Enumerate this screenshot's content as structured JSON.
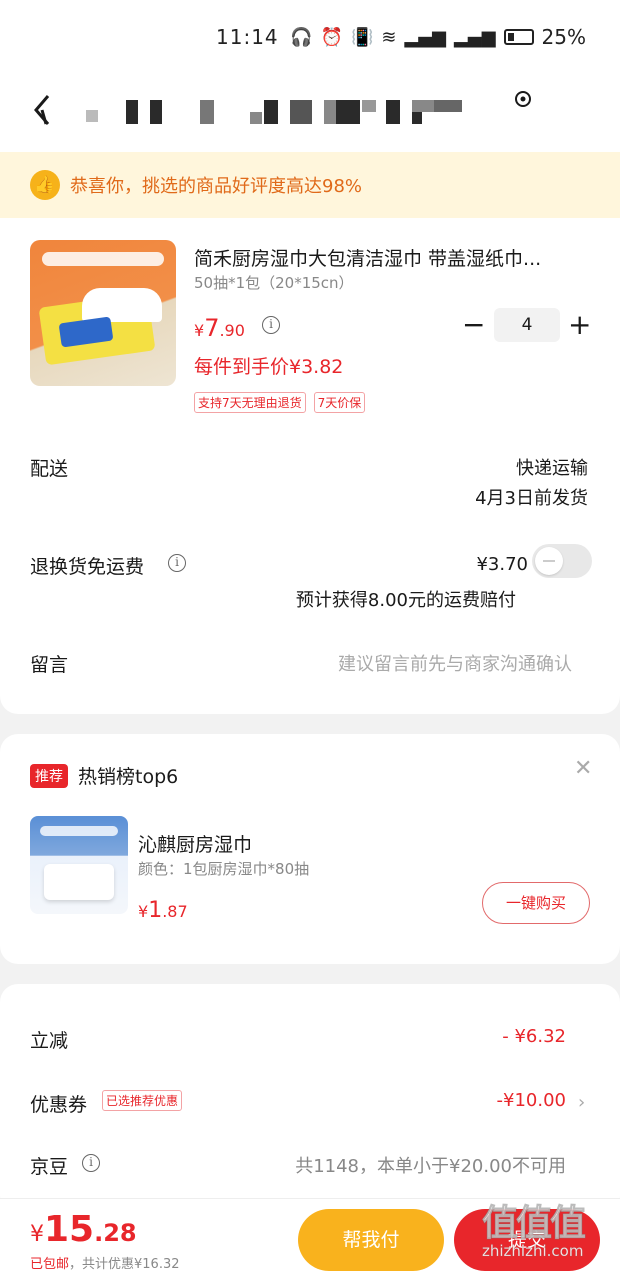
{
  "status_bar": {
    "time": "11:14",
    "battery": "25%"
  },
  "nav": {
    "back_icon": "back-chevron-icon",
    "location_icon": "location-pin-icon"
  },
  "banner": {
    "text": "恭喜你，挑选的商品好评度高达98%",
    "icon": "thumbs-up-icon"
  },
  "product": {
    "title": "简禾厨房湿巾大包清洁湿巾 带盖湿纸巾...",
    "spec": "50抽*1包（20*15cn）",
    "price_symbol": "¥",
    "price_int": "7",
    "price_dec": ".90",
    "net_price": "每件到手价¥3.82",
    "tags": [
      "支持7天无理由退货",
      "7天价保"
    ],
    "quantity": "4"
  },
  "delivery": {
    "label": "配送",
    "method": "快递运输",
    "ship_date": "4月3日前发货"
  },
  "return_shipping": {
    "label": "退换货免运费",
    "price": "¥3.70",
    "note": "预计获得8.00元的运费赔付",
    "enabled": false
  },
  "message": {
    "label": "留言",
    "placeholder": "建议留言前先与商家沟通确认"
  },
  "hot_list": {
    "badge": "推荐",
    "title": "热销榜top6",
    "item": {
      "name": "沁麒厨房湿巾",
      "spec": "颜色：1包厨房湿巾*80抽",
      "price_symbol": "¥",
      "price_int": "1",
      "price_dec": ".87",
      "buy_label": "一键购买"
    }
  },
  "summary": {
    "discount_label": "立减",
    "discount_value": "- ¥6.32",
    "coupon_label": "优惠券",
    "coupon_badge": "已选推荐优惠",
    "coupon_value": "-¥10.00",
    "beans_label": "京豆",
    "beans_note": "共1148，本单小于¥20.00不可用"
  },
  "footer": {
    "total_symbol": "¥",
    "total_int": "15",
    "total_dec": ".28",
    "free_shipping": "已包邮",
    "savings": "，共计优惠¥16.32",
    "pay_for_me": "帮我付",
    "submit": "提交"
  },
  "watermark": {
    "glyphs": "值值值",
    "url": "zhizhizhi.com"
  },
  "colors": {
    "accent_red": "#e8262b",
    "banner_bg": "#fff6dc",
    "banner_text": "#e06a1a",
    "pay_yellow": "#f9b21d"
  }
}
